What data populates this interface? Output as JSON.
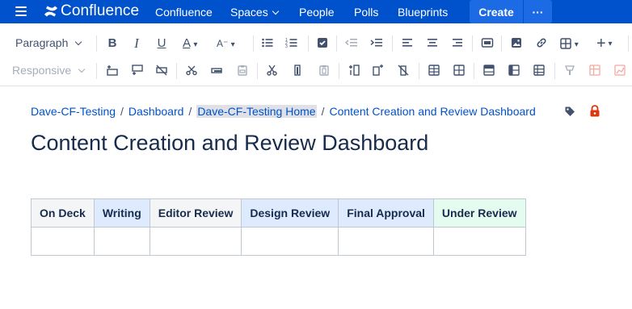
{
  "topnav": {
    "brand": "Confluence",
    "items": [
      "Confluence",
      "Spaces",
      "People",
      "Polls",
      "Blueprints"
    ],
    "create_label": "Create",
    "more_label": "···"
  },
  "toolbar": {
    "paragraph_label": "Paragraph",
    "responsive_label": "Responsive"
  },
  "breadcrumb": {
    "items": [
      "Dave-CF-Testing",
      "Dashboard",
      "Dave-CF-Testing Home",
      "Content Creation and Review Dashboard"
    ],
    "separator": "/"
  },
  "page": {
    "title": "Content Creation and Review Dashboard"
  },
  "table": {
    "headers": [
      {
        "label": "On Deck",
        "bg": "#f4f5f7"
      },
      {
        "label": "Writing",
        "bg": "#deebff"
      },
      {
        "label": "Editor Review",
        "bg": "#f4f5f7"
      },
      {
        "label": "Design Review",
        "bg": "#deebff"
      },
      {
        "label": "Final Approval",
        "bg": "#deebff"
      },
      {
        "label": "Under Review",
        "bg": "#e3fcef"
      }
    ],
    "rows": [
      [
        "",
        "",
        "",
        "",
        "",
        ""
      ]
    ]
  },
  "colors": {
    "nav_bg": "#0052cc",
    "create_bg": "#1d6ae5",
    "link": "#0052cc",
    "restricted": "#de350b"
  }
}
